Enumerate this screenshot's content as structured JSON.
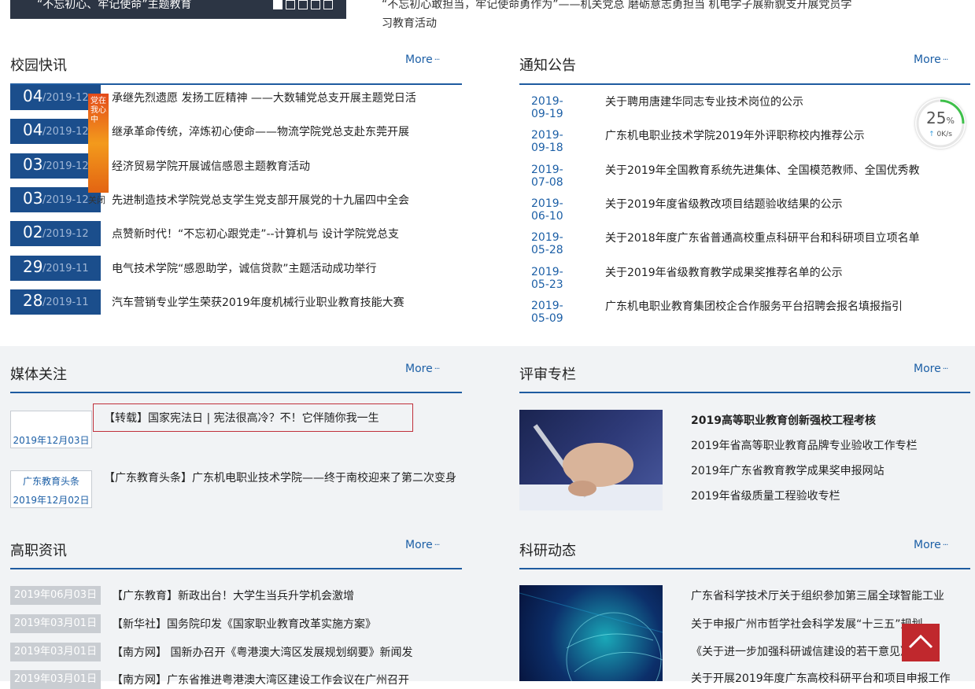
{
  "banner": {
    "caption": "“不忘初心、牢记使命”主题教育",
    "headline": "“不忘初心敢担当，牢记使命勇作为”——机关党总  磨砺意志勇担当 机电学子展新貌支开展党员学习教育活动"
  },
  "campus_news": {
    "title": "校园快讯",
    "more": "More",
    "items": [
      {
        "day": "04",
        "ym": "/2019-12",
        "title": "承继先烈遗愿 发扬工匠精神 ——大数辅党总支开展主题党日活"
      },
      {
        "day": "04",
        "ym": "/2019-12",
        "title": "继承革命传统，淬炼初心使命——物流学院党总支赴东莞开展"
      },
      {
        "day": "03",
        "ym": "/2019-12",
        "title": "经济贸易学院开展诚信感恩主题教育活动"
      },
      {
        "day": "03",
        "ym": "/2019-12",
        "title": "先进制造技术学院党总支学生党支部开展党的十九届四中全会"
      },
      {
        "day": "02",
        "ym": "/2019-12",
        "title": "点赞新时代！“不忘初心跟党走”--计算机与 设计学院党总支"
      },
      {
        "day": "29",
        "ym": "/2019-11",
        "title": "电气技术学院“感恩助学，诚信贷款”主题活动成功举行"
      },
      {
        "day": "28",
        "ym": "/2019-11",
        "title": "汽车营销专业学生荣获2019年度机械行业职业教育技能大赛"
      }
    ]
  },
  "notices": {
    "title": "通知公告",
    "more": "More",
    "items": [
      {
        "date": "2019-09-19",
        "title": "关于聘用唐建华同志专业技术岗位的公示"
      },
      {
        "date": "2019-09-18",
        "title": "广东机电职业技术学院2019年外评职称校内推荐公示"
      },
      {
        "date": "2019-07-08",
        "title": "关于2019年全国教育系统先进集体、全国模范教师、全国优秀教"
      },
      {
        "date": "2019-06-10",
        "title": "关于2019年度省级教改项目结题验收结果的公示"
      },
      {
        "date": "2019-05-28",
        "title": "关于2018年度广东省普通高校重点科研平台和科研项目立项名单"
      },
      {
        "date": "2019-05-23",
        "title": "关于2019年省级教育教学成果奖推荐名单的公示"
      },
      {
        "date": "2019-05-09",
        "title": "广东机电职业教育集团校企合作服务平台招聘会报名填报指引"
      }
    ]
  },
  "float_ad": {
    "text": "党在我心中",
    "close": "关闭"
  },
  "speed_widget": {
    "percent": "25",
    "unit": "%",
    "rate": "0K/s",
    "percent_value": 0.25
  },
  "media": {
    "title": "媒体关注",
    "more": "More",
    "items": [
      {
        "source": "",
        "date": "2019年12月03日",
        "title": "【转载】国家宪法日 | 宪法很高冷？不！它伴随你我一生"
      },
      {
        "source": "广东教育头条",
        "date": "2019年12月02日",
        "title": "【广东教育头条】广东机电职业技术学院——终于南校迎来了第二次变身"
      }
    ]
  },
  "review": {
    "title": "评审专栏",
    "more": "More",
    "links": [
      "2019高等职业教育创新强校工程考核",
      "2019年省高等职业教育品牌专业验收工作专栏",
      "2019年广东省教育教学成果奖申报网站",
      "2019年省级质量工程验收专栏"
    ]
  },
  "vocational": {
    "title": "高职资讯",
    "more": "More",
    "items": [
      {
        "date": "2019年06月03日",
        "title": "【广东教育】新政出台！大学生当兵升学机会激增"
      },
      {
        "date": "2019年03月01日",
        "title": "【新华社】国务院印发《国家职业教育改革实施方案》"
      },
      {
        "date": "2019年03月01日",
        "title": "【南方网】 国新办召开《粤港澳大湾区发展规划纲要》新闻发"
      },
      {
        "date": "2019年03月01日",
        "title": "【南方网】广东省推进粤港澳大湾区建设工作会议在广州召开"
      }
    ]
  },
  "research": {
    "title": "科研动态",
    "more": "More",
    "links": [
      "广东省科学技术厅关于组织参加第三届全球智能工业",
      "关于申报广州市哲学社会科学发展“十三五”规划",
      "《关于进一步加强科研诚信建设的若干意见》（中共",
      "关于开展2019年度广东高校科研平台和项目申报工作"
    ]
  },
  "colors": {
    "primary": "#1b4e8c",
    "link": "#1c5fa6",
    "highlight": "#c0303a",
    "to_top": "#c0282d"
  }
}
